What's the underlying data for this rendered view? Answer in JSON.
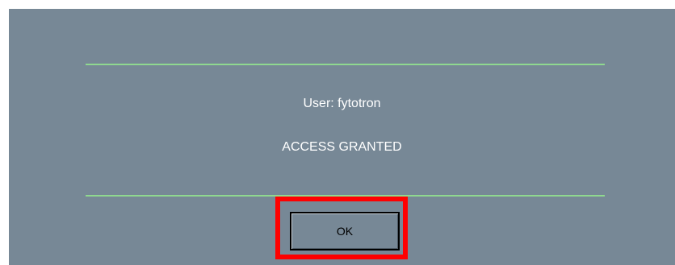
{
  "dialog": {
    "user_line": "User: fytotron",
    "status_line": "ACCESS GRANTED",
    "ok_label": "OK"
  },
  "colors": {
    "background": "#778896",
    "divider": "#8fd88f",
    "text": "#ffffff",
    "highlight": "#ff0000"
  }
}
